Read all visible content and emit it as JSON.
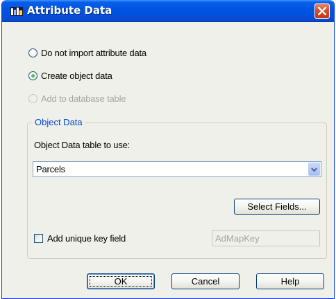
{
  "window": {
    "title": "Attribute Data"
  },
  "import_options": [
    {
      "label": "Do not import attribute data",
      "selected": false,
      "enabled": true
    },
    {
      "label": "Create object data",
      "selected": true,
      "enabled": true
    },
    {
      "label": "Add to database table",
      "selected": false,
      "enabled": false
    }
  ],
  "object_data": {
    "group_label": "Object Data",
    "table_label": "Object Data table to use:",
    "table_value": "Parcels",
    "select_fields_label": "Select Fields...",
    "unique_key_label": "Add unique key field",
    "unique_key_checked": false,
    "key_field_value": "AdMapKey"
  },
  "buttons": {
    "ok": "OK",
    "cancel": "Cancel",
    "help": "Help"
  },
  "icons": {
    "app": "attribute-data-app-icon",
    "close": "close-icon",
    "dropdown": "chevron-down-icon"
  },
  "colors": {
    "titlebar": "#0054e3",
    "group_label": "#0046d5",
    "close_button": "#d74c28",
    "dialog_bg": "#f0f0ea"
  }
}
